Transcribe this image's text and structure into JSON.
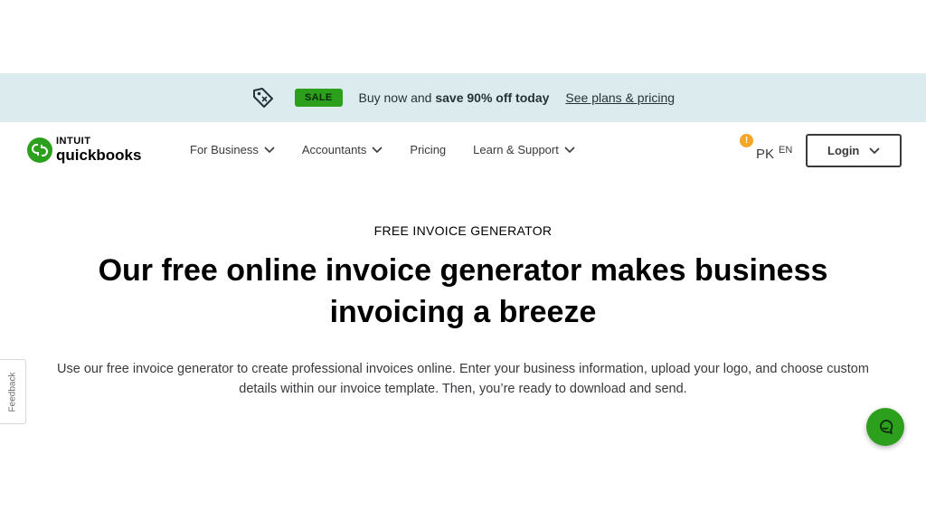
{
  "promo": {
    "sale_label": "SALE",
    "text_prefix": "Buy now and ",
    "text_bold": "save 90% off today",
    "link_label": "See plans & pricing"
  },
  "logo": {
    "brand_top": "INTUIT",
    "brand_bottom": "quickbooks"
  },
  "nav": {
    "items": [
      {
        "label": "For Business",
        "has_dropdown": true
      },
      {
        "label": "Accountants",
        "has_dropdown": true
      },
      {
        "label": "Pricing",
        "has_dropdown": false
      },
      {
        "label": "Learn & Support",
        "has_dropdown": true
      }
    ]
  },
  "locale": {
    "alert_mark": "!",
    "country": "PK",
    "language": "EN"
  },
  "login": {
    "label": "Login"
  },
  "hero": {
    "eyebrow": "FREE INVOICE GENERATOR",
    "headline": "Our free online invoice generator makes business invoicing a breeze",
    "description": "Use our free invoice generator to create professional invoices online. Enter your business information, upload your logo, and choose custom details within our invoice template. Then, you’re ready to download and send."
  },
  "feedback": {
    "label": "Feedback"
  },
  "colors": {
    "brand_green": "#2ca01c",
    "promo_bg": "#dcebee",
    "alert_orange": "#f5a623",
    "text_dark": "#393a3d"
  },
  "icons": {
    "promo": "price-tag-icon",
    "chevron": "chevron-down-icon",
    "chat": "chat-bubble-icon"
  }
}
